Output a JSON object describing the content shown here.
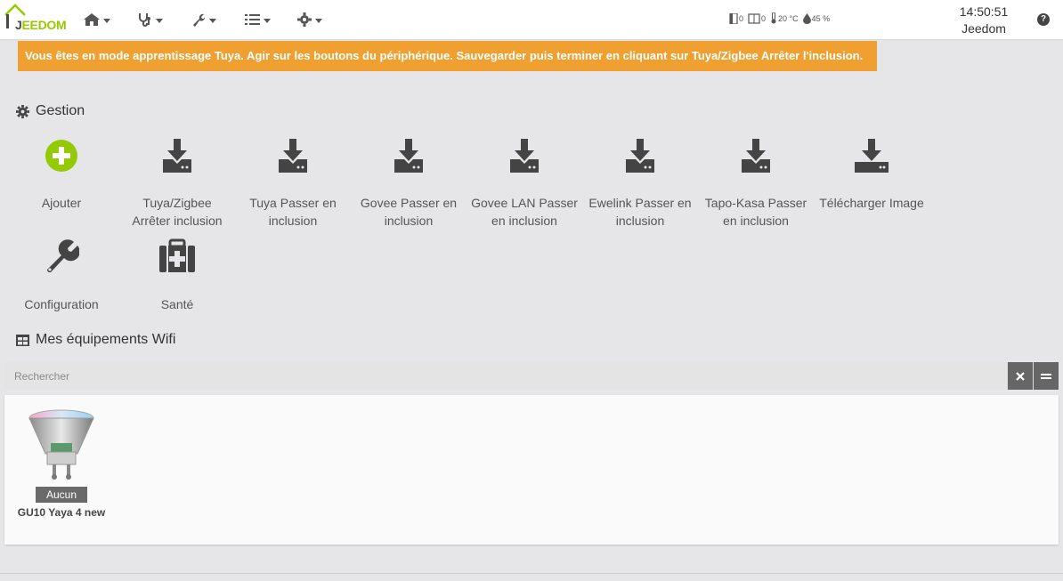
{
  "brand": {
    "logo_text_j": "J",
    "logo_text_rest": "EEDOM"
  },
  "navbar": {
    "menus": [
      {
        "icon": "home-icon"
      },
      {
        "icon": "stethoscope-icon"
      },
      {
        "icon": "wrench-icon"
      },
      {
        "icon": "list-check-icon"
      },
      {
        "icon": "gear-icon"
      }
    ],
    "widgets": {
      "door_count": "0",
      "window_count": "0",
      "temperature": "20 °C",
      "humidity": "45 %"
    },
    "time": "14:50:51",
    "user": "Jeedom",
    "help": "?"
  },
  "alert": {
    "text": "Vous êtes en mode apprentissage Tuya. Agir sur les boutons du périphérique. Sauvegarder puis terminer en cliquant sur Tuya/Zigbee Arrêter l'inclusion.",
    "color": "#f0a030"
  },
  "gestion": {
    "title": "Gestion",
    "actions": [
      {
        "label": "Ajouter",
        "icon": "plus-circle-icon"
      },
      {
        "label": "Tuya/Zigbee Arrêter inclusion",
        "icon": "download-icon"
      },
      {
        "label": "Tuya Passer en inclusion",
        "icon": "download-icon"
      },
      {
        "label": "Govee Passer en inclusion",
        "icon": "download-icon"
      },
      {
        "label": "Govee LAN Passer en inclusion",
        "icon": "download-icon"
      },
      {
        "label": "Ewelink Passer en inclusion",
        "icon": "download-icon"
      },
      {
        "label": "Tapo-Kasa Passer en inclusion",
        "icon": "download-icon"
      },
      {
        "label": "Télécharger Image",
        "icon": "download-drive-icon"
      },
      {
        "label": "Configuration",
        "icon": "wrench-icon"
      },
      {
        "label": "Santé",
        "icon": "medkit-icon"
      }
    ],
    "accent": "#94ca02"
  },
  "equipments": {
    "title": "Mes équipements Wifi",
    "search_placeholder": "Rechercher",
    "clear_icon": "close-icon",
    "toggle_icon": "equals-icon",
    "items": [
      {
        "badge": "Aucun",
        "name": "GU10 Yaya 4 new",
        "image": "gu10-bulb-image"
      }
    ]
  }
}
